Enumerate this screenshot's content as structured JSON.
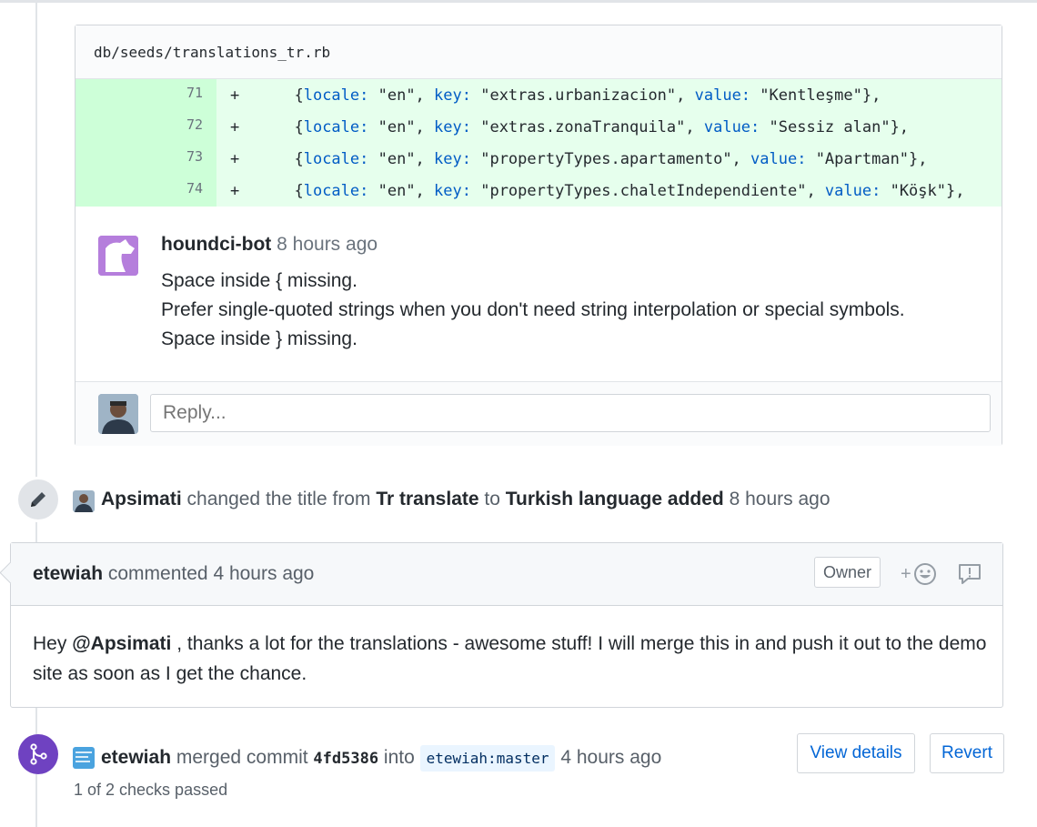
{
  "review": {
    "file_path": "db/seeds/translations_tr.rb",
    "diff_lines": [
      {
        "num": "71",
        "sign": "+",
        "pre": "  {",
        "k1": "locale:",
        "v1": " \"en\", ",
        "k2": "key:",
        "v2": " \"extras.urbanizacion\", ",
        "k3": "value:",
        "v3": " \"Kentleşme\"},"
      },
      {
        "num": "72",
        "sign": "+",
        "pre": "  {",
        "k1": "locale:",
        "v1": " \"en\", ",
        "k2": "key:",
        "v2": " \"extras.zonaTranquila\", ",
        "k3": "value:",
        "v3": " \"Sessiz alan\"},"
      },
      {
        "num": "73",
        "sign": "+",
        "pre": "  {",
        "k1": "locale:",
        "v1": " \"en\", ",
        "k2": "key:",
        "v2": " \"propertyTypes.apartamento\", ",
        "k3": "value:",
        "v3": " \"Apartman\"},"
      },
      {
        "num": "74",
        "sign": "+",
        "pre": "  {",
        "k1": "locale:",
        "v1": " \"en\", ",
        "k2": "key:",
        "v2": " \"propertyTypes.chaletIndependiente\", ",
        "k3": "value:",
        "v3": " \"Köşk\"},"
      }
    ],
    "comment": {
      "author": "houndci-bot",
      "time": "8 hours ago",
      "lines": [
        "Space inside { missing.",
        "Prefer single-quoted strings when you don't need string interpolation or special symbols.",
        "Space inside } missing."
      ]
    },
    "reply_placeholder": "Reply..."
  },
  "title_event": {
    "actor": "Apsimati",
    "action": "changed the title from",
    "old_title": "Tr translate",
    "to_word": "to",
    "new_title": "Turkish language added",
    "time": "8 hours ago"
  },
  "owner_comment": {
    "author": "etewiah",
    "action": "commented",
    "time": "4 hours ago",
    "badge": "Owner",
    "react_plus": "+",
    "body_pre": "Hey ",
    "mention": "@Apsimati",
    "body_post": " , thanks a lot for the translations - awesome stuff! I will merge this in and push it out to the demo site as soon as I get the chance."
  },
  "merge_event": {
    "actor": "etewiah",
    "action": "merged commit",
    "sha": "4fd5386",
    "into_word": "into",
    "branch": "etewiah:master",
    "time": "4 hours ago",
    "view_details_label": "View details",
    "revert_label": "Revert",
    "checks": "1 of 2 checks passed"
  },
  "colors": {
    "diff_add_bg": "#e6ffed",
    "diff_num_bg": "#cdffd8",
    "keyword": "#005cc5",
    "merge_purple": "#6f42c1",
    "link_blue": "#0366d6"
  }
}
